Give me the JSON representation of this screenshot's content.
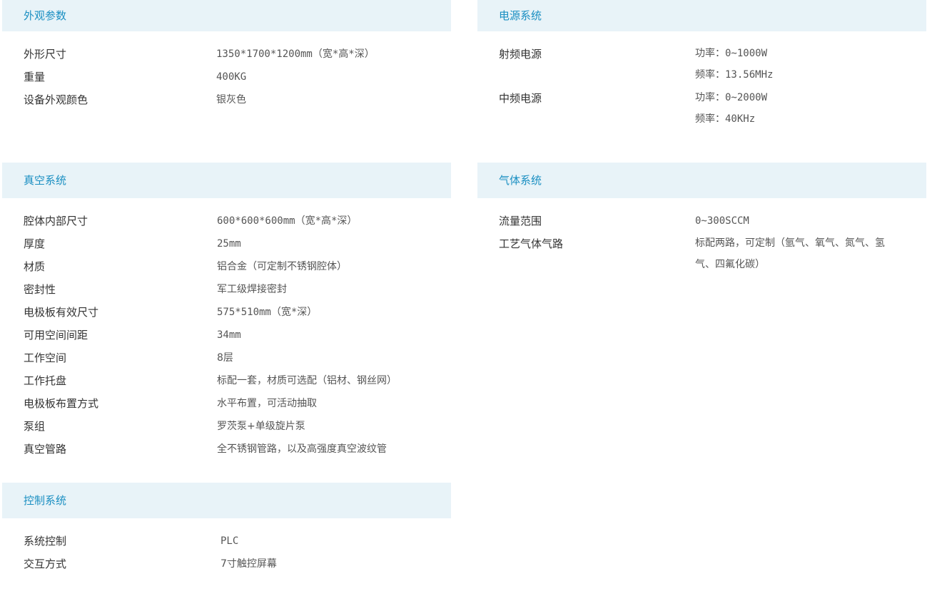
{
  "appearance": {
    "title": "外观参数",
    "rows": [
      {
        "label": "外形尺寸",
        "value": "1350*1700*1200mm（宽*高*深）"
      },
      {
        "label": "重量",
        "value": "400KG"
      },
      {
        "label": "设备外观颜色",
        "value": "银灰色"
      }
    ]
  },
  "power": {
    "title": "电源系统",
    "rows": [
      {
        "label": "射频电源",
        "lines": [
          "功率：0~1000W",
          "频率：13.56MHz"
        ]
      },
      {
        "label": "中频电源",
        "lines": [
          "功率：0~2000W",
          "频率：40KHz"
        ]
      }
    ]
  },
  "vacuum": {
    "title": "真空系统",
    "rows": [
      {
        "label": "腔体内部尺寸",
        "value": "600*600*600mm（宽*高*深）"
      },
      {
        "label": "厚度",
        "value": "25mm"
      },
      {
        "label": "材质",
        "value": "铝合金（可定制不锈钢腔体）"
      },
      {
        "label": "密封性",
        "value": "军工级焊接密封"
      },
      {
        "label": "电极板有效尺寸",
        "value": "575*510mm（宽*深）"
      },
      {
        "label": "可用空间间距",
        "value": "34mm"
      },
      {
        "label": "工作空间",
        "value": "8层"
      },
      {
        "label": "工作托盘",
        "value": "标配一套，材质可选配（铝材、钢丝网）"
      },
      {
        "label": "电极板布置方式",
        "value": "水平布置，可活动抽取"
      },
      {
        "label": "泵组",
        "value": "罗茨泵+单级旋片泵"
      },
      {
        "label": "真空管路",
        "value": "全不锈钢管路，以及高强度真空波纹管"
      }
    ]
  },
  "gas": {
    "title": "气体系统",
    "rows": [
      {
        "label": "流量范围",
        "value": "0~300SCCM"
      },
      {
        "label": "工艺气体气路",
        "lines": [
          "标配两路，可定制（氩气、氧气、氮气、氢",
          "气、四氟化碳）"
        ]
      }
    ]
  },
  "control": {
    "title": "控制系统",
    "rows": [
      {
        "label": "系统控制",
        "value": "PLC"
      },
      {
        "label": "交互方式",
        "value": "7寸触控屏幕"
      }
    ]
  }
}
